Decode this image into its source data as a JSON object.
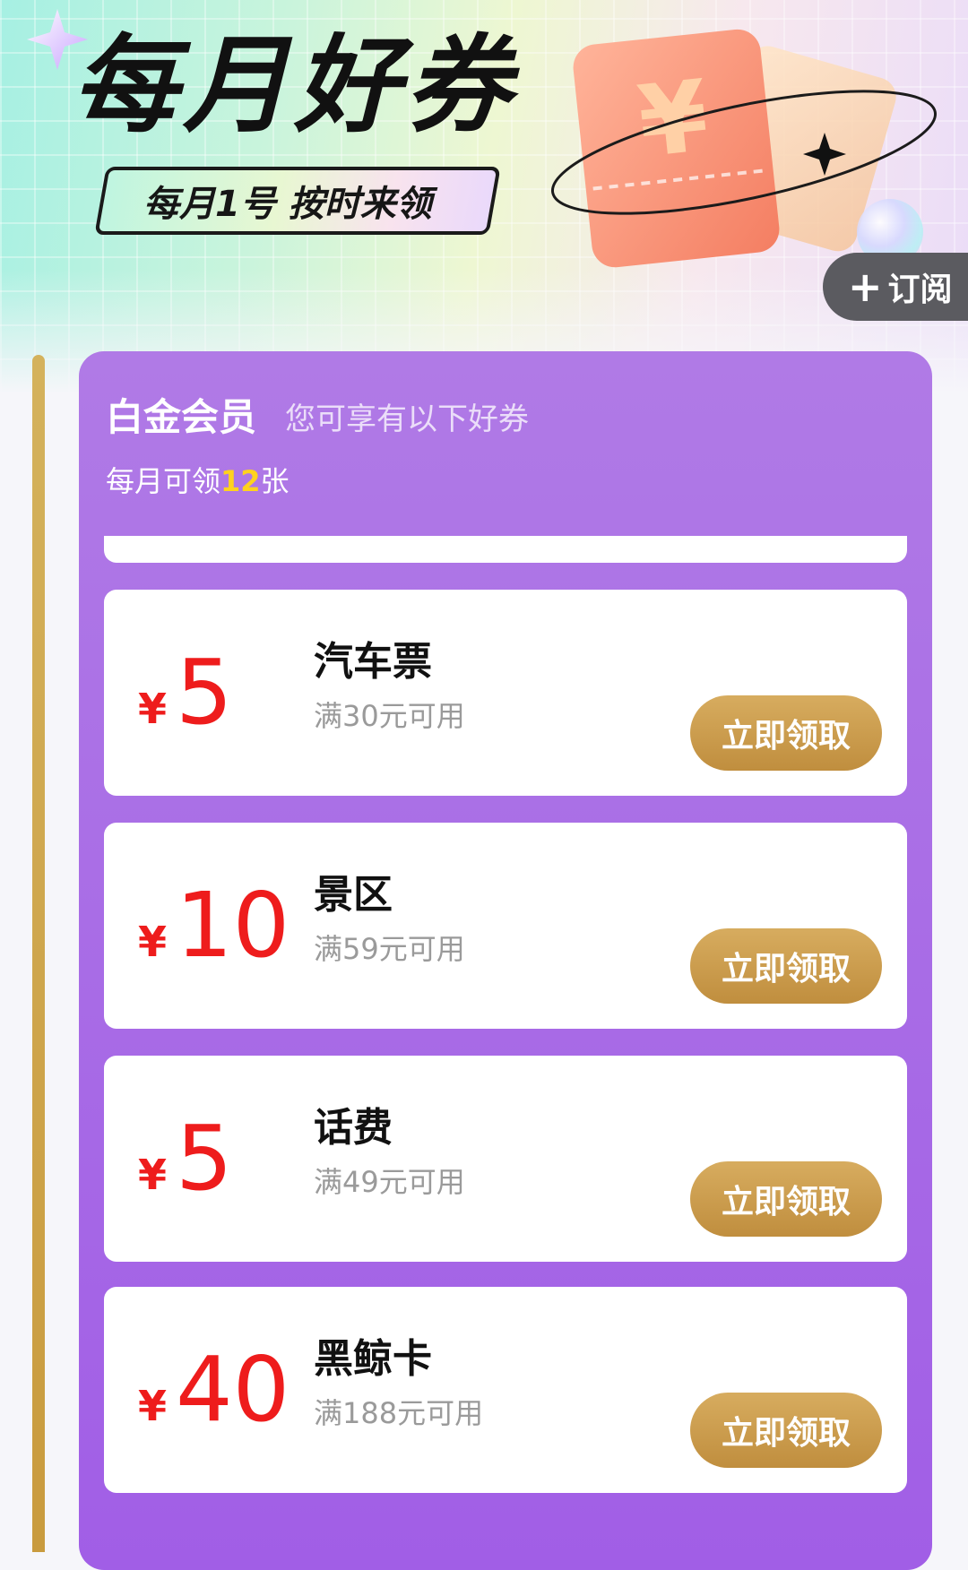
{
  "header": {
    "title": "每月好券",
    "slogan": "每月1号 按时来领",
    "subscribe_label": "订阅",
    "ticket_symbol": "¥"
  },
  "tier": {
    "name": "白金会员",
    "description": "您可享有以下好券",
    "monthly_prefix": "每月可领",
    "monthly_count": "12",
    "monthly_suffix": "张"
  },
  "coupons": [
    {
      "currency": "¥",
      "amount": "5",
      "name": "汽车票",
      "condition": "满30元可用",
      "action": "立即领取"
    },
    {
      "currency": "¥",
      "amount": "10",
      "name": "景区",
      "condition": "满59元可用",
      "action": "立即领取"
    },
    {
      "currency": "¥",
      "amount": "5",
      "name": "话费",
      "condition": "满49元可用",
      "action": "立即领取"
    },
    {
      "currency": "¥",
      "amount": "40",
      "name": "黑鲸卡",
      "condition": "满188元可用",
      "action": "立即领取"
    }
  ],
  "colors": {
    "panel": "#a86ce6",
    "price": "#ee1c1c",
    "button": "#c9994a",
    "count_highlight": "#ffd21e"
  }
}
